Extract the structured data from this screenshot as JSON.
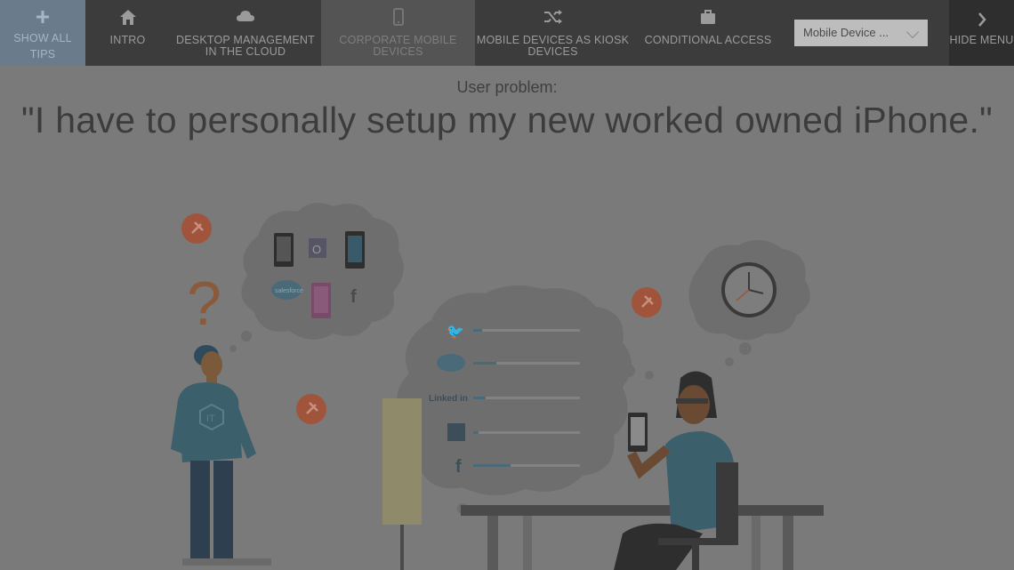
{
  "nav": {
    "show_all_tips": "SHOW ALL TIPS",
    "items": [
      {
        "label": "INTRO",
        "icon": "home-icon"
      },
      {
        "label": "DESKTOP MANAGEMENT IN THE CLOUD",
        "icon": "cloud-icon"
      },
      {
        "label": "CORPORATE MOBILE DEVICES",
        "icon": "mobile-icon"
      },
      {
        "label": "MOBILE DEVICES AS KIOSK DEVICES",
        "icon": "shuffle-icon"
      },
      {
        "label": "CONDITIONAL ACCESS",
        "icon": "briefcase-icon"
      }
    ],
    "select_value": "Mobile Device ...",
    "hide_menu": "HIDE MENU"
  },
  "content": {
    "problem_label": "User problem:",
    "quote": "\"I have to personally setup my new worked owned iPhone.\"",
    "linkedin_text": "Linked in",
    "salesforce_text": "salesforce"
  },
  "colors": {
    "background": "#7a7a7a",
    "nav_bg": "#3c3c3c",
    "nav_active": "#545454",
    "show_all_bg": "#6a7b8b",
    "pin": "#a0543c"
  }
}
